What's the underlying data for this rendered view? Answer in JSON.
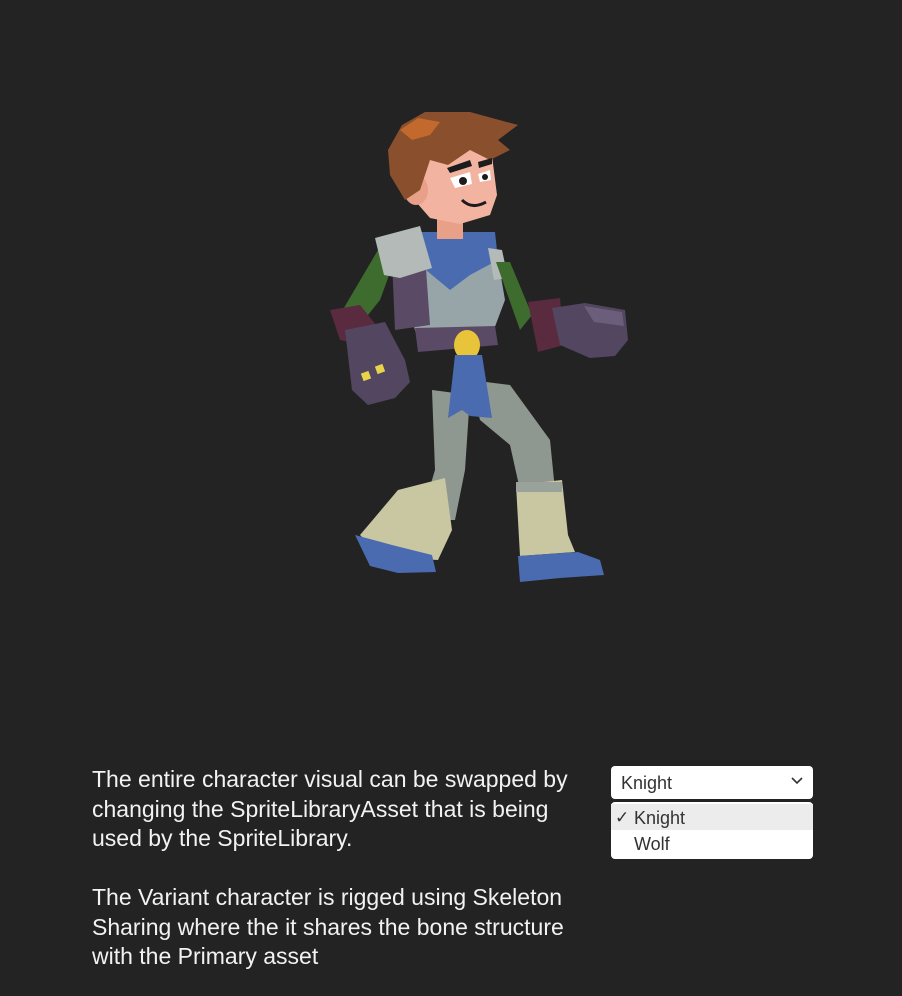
{
  "description": {
    "paragraph1": "The entire character visual can be swapped by changing the SpriteLibraryAsset that is being used by the SpriteLibrary.",
    "paragraph2": "The Variant character is rigged using Skeleton Sharing where the it shares the bone structure with the Primary asset"
  },
  "dropdown": {
    "selected": "Knight",
    "options": [
      {
        "label": "Knight",
        "checked": true,
        "check_glyph": "✓"
      },
      {
        "label": "Wolf",
        "checked": false,
        "check_glyph": ""
      }
    ]
  },
  "colors": {
    "background": "#232323",
    "text": "#f2f2f2",
    "dropdown_bg": "#ffffff",
    "dropdown_text": "#323232"
  },
  "icons": {
    "dropdown_arrow": "chevron-down-icon",
    "check": "checkmark-icon"
  }
}
